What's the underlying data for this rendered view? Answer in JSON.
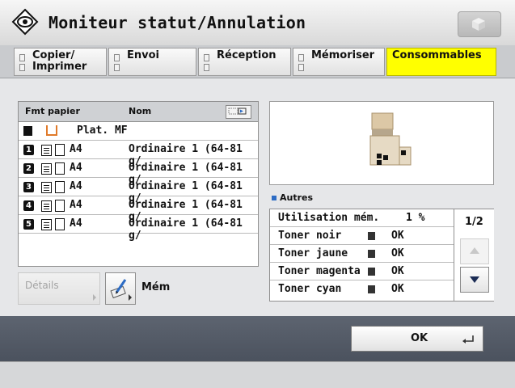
{
  "header": {
    "title": "Moniteur statut/Annulation",
    "icon": "eye-icon",
    "right_button_icon": "cube-icon"
  },
  "tabs": [
    {
      "label": "Copier/ Imprimer",
      "active": false
    },
    {
      "label": "Envoi",
      "active": false
    },
    {
      "label": "Réception",
      "active": false
    },
    {
      "label": "Mémoriser",
      "active": false
    },
    {
      "label": "Consommables",
      "active": true
    }
  ],
  "paper_list": {
    "col_format": "Fmt papier",
    "col_name": "Nom",
    "rows": [
      {
        "label": "Plat. MF"
      },
      {
        "num": "1",
        "size": "A4",
        "name": "Ordinaire 1 (64-81 g/"
      },
      {
        "num": "2",
        "size": "A4",
        "name": "Ordinaire 1 (64-81 g/"
      },
      {
        "num": "3",
        "size": "A4",
        "name": "Ordinaire 1 (64-81 g/"
      },
      {
        "num": "4",
        "size": "A4",
        "name": "Ordinaire 1 (64-81 g/"
      },
      {
        "num": "5",
        "size": "A4",
        "name": "Ordinaire 1 (64-81 g/"
      }
    ]
  },
  "buttons": {
    "details": "Détails",
    "mem": "Mém",
    "ok": "OK"
  },
  "autres_label": "Autres",
  "status": {
    "rows": [
      {
        "key": "Utilisation mém.",
        "value": "1 %"
      },
      {
        "key": "Toner noir",
        "value": "OK"
      },
      {
        "key": "Toner jaune",
        "value": "OK"
      },
      {
        "key": "Toner magenta",
        "value": "OK"
      },
      {
        "key": "Toner cyan",
        "value": "OK"
      }
    ],
    "page": "1/2"
  },
  "colors": {
    "active_tab": "#ffff00",
    "bullet": "#2d6cc4",
    "bottom_bar": "#555c67"
  }
}
